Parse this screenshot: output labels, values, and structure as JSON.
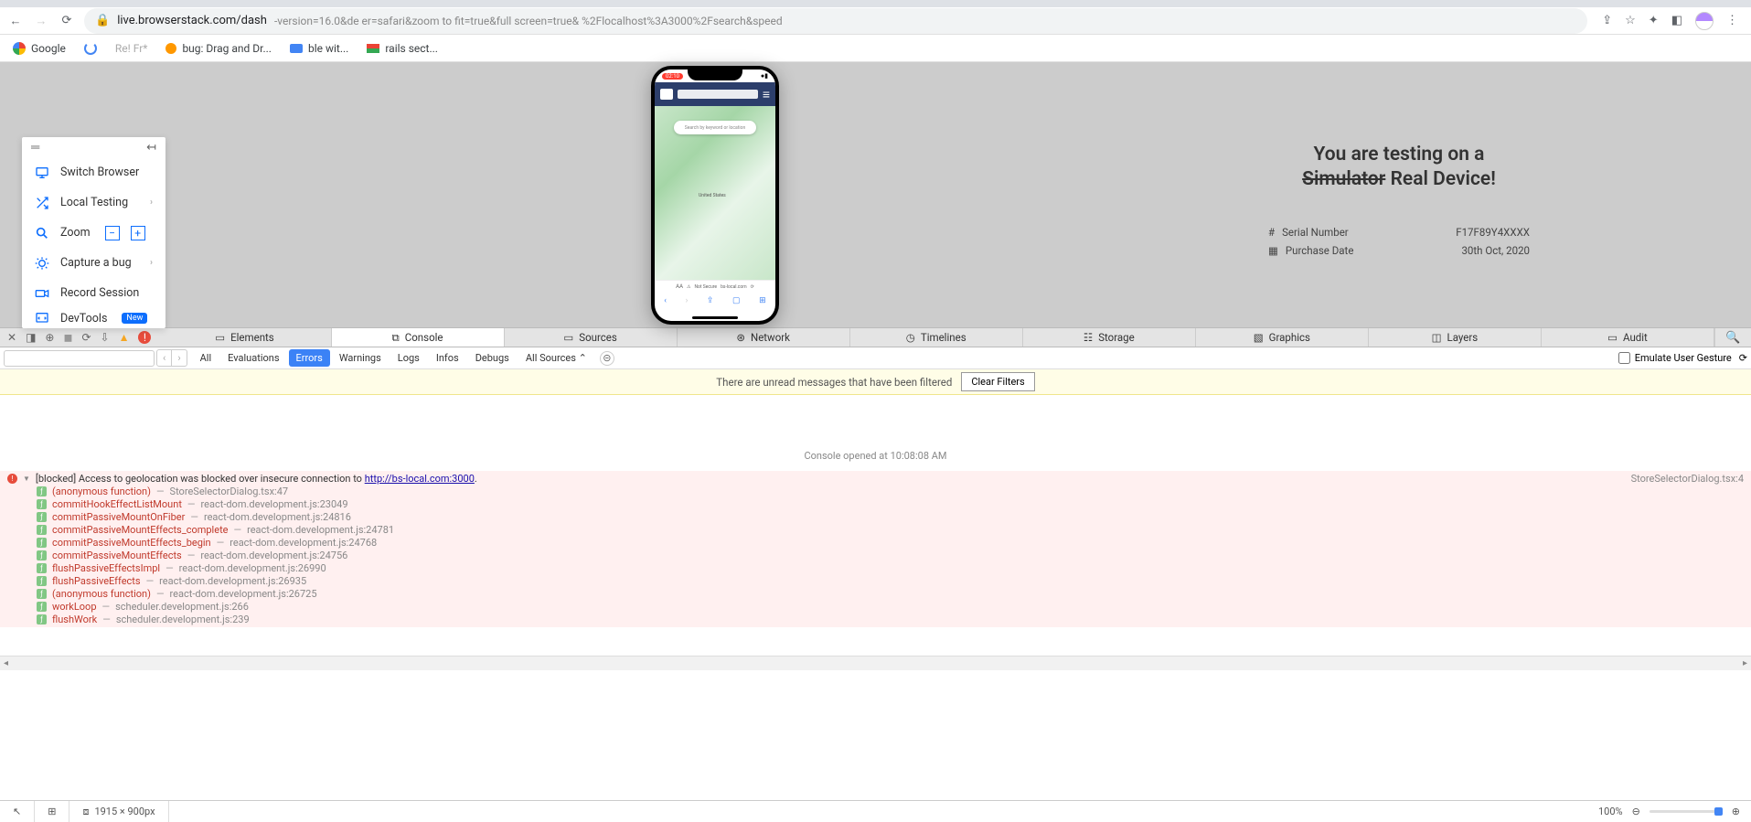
{
  "browser": {
    "url": "live.browserstack.com/dash",
    "url_suffix": "-version=16.0&de         er=safari&zoom to fit=true&full screen=true&         %2Flocalhost%3A3000%2Fsearch&speed",
    "bookmarks": [
      "Google",
      "",
      "",
      "bug: Drag and Dr...",
      "ble wit...",
      "rails sect..."
    ]
  },
  "sidebar": {
    "items": [
      {
        "label": "Switch Browser"
      },
      {
        "label": "Local Testing"
      },
      {
        "label": "Zoom"
      },
      {
        "label": "Capture a bug"
      },
      {
        "label": "Record Session"
      },
      {
        "label": "DevTools",
        "badge": "New"
      }
    ]
  },
  "phone": {
    "time": "02:10",
    "search_placeholder": "Search by keyword or location",
    "map_label": "United States",
    "addr_prefix": "Not Secure",
    "addr": "bs-local.com"
  },
  "info": {
    "line1": "You are testing on a",
    "strike": "Simulator",
    "line2_rest": " Real Device!",
    "rows": [
      {
        "icon": "#",
        "label": "Serial Number",
        "value": "F17F89Y4XXXX"
      },
      {
        "icon": "cal",
        "label": "Purchase Date",
        "value": "30th Oct, 2020"
      }
    ]
  },
  "devtools": {
    "tabs": [
      "Elements",
      "Console",
      "Sources",
      "Network",
      "Timelines",
      "Storage",
      "Graphics",
      "Layers",
      "Audit"
    ],
    "selected": 1,
    "filters": [
      "All",
      "Evaluations",
      "Errors",
      "Warnings",
      "Logs",
      "Infos",
      "Debugs",
      "All Sources"
    ],
    "filter_active": 2,
    "emulate": "Emulate User Gesture",
    "banner": "There are unread messages that have been filtered",
    "clear": "Clear Filters",
    "opened": "Console opened at 10:08:08 AM",
    "error": {
      "prefix": "[blocked] Access to geolocation was blocked over insecure connection to ",
      "url": "http://bs-local.com:3000",
      "suffix": ".",
      "source": "StoreSelectorDialog.tsx:4"
    },
    "stack": [
      {
        "fn": "(anonymous function)",
        "loc": "StoreSelectorDialog.tsx:47"
      },
      {
        "fn": "commitHookEffectListMount",
        "loc": "react-dom.development.js:23049"
      },
      {
        "fn": "commitPassiveMountOnFiber",
        "loc": "react-dom.development.js:24816"
      },
      {
        "fn": "commitPassiveMountEffects_complete",
        "loc": "react-dom.development.js:24781"
      },
      {
        "fn": "commitPassiveMountEffects_begin",
        "loc": "react-dom.development.js:24768"
      },
      {
        "fn": "commitPassiveMountEffects",
        "loc": "react-dom.development.js:24756"
      },
      {
        "fn": "flushPassiveEffectsImpl",
        "loc": "react-dom.development.js:26990"
      },
      {
        "fn": "flushPassiveEffects",
        "loc": "react-dom.development.js:26935"
      },
      {
        "fn": "(anonymous function)",
        "loc": "react-dom.development.js:26725"
      },
      {
        "fn": "workLoop",
        "loc": "scheduler.development.js:266"
      },
      {
        "fn": "flushWork",
        "loc": "scheduler.development.js:239"
      }
    ]
  },
  "status": {
    "dims": "1915 × 900px",
    "zoom": "100%"
  }
}
